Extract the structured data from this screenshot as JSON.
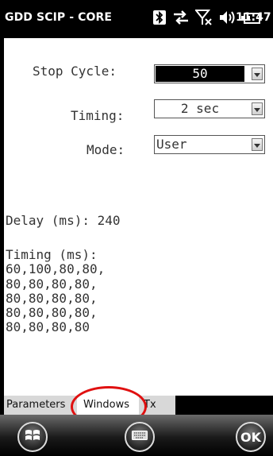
{
  "titlebar": {
    "app_title": "GDD SCIP - CORE",
    "clock": "11:47",
    "status_icons": [
      "bluetooth-icon",
      "data-connection-icon",
      "no-signal-icon",
      "volume-icon",
      "battery-icon"
    ]
  },
  "form": {
    "stop_cycle": {
      "label": "Stop Cycle:",
      "value": "50"
    },
    "timing": {
      "label": "Timing:",
      "value": "2 sec"
    },
    "mode": {
      "label": "Mode:",
      "value": "User"
    }
  },
  "info": {
    "delay_line": "Delay (ms): 240",
    "timing_heading": "Timing (ms):",
    "timing_lines": [
      "60,100,80,80,",
      "80,80,80,80,",
      "80,80,80,80,",
      "80,80,80,80,",
      "80,80,80,80"
    ]
  },
  "tabs": [
    {
      "label": "Parameters",
      "active": false
    },
    {
      "label": "Windows",
      "active": true
    },
    {
      "label": "Tx",
      "active": false
    }
  ],
  "softkeys": {
    "ok_label": "OK"
  },
  "colors": {
    "highlight": "#e01010",
    "screen_background": "#000000",
    "content_background": "#ffffff"
  }
}
